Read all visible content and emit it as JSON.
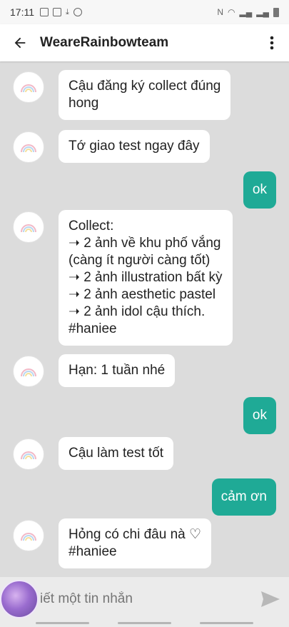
{
  "status_bar": {
    "time": "17:11"
  },
  "header": {
    "title": "WeareRainbowteam"
  },
  "messages": [
    {
      "side": "in",
      "text": "Cậu đăng ký collect đúng\nhong"
    },
    {
      "side": "in",
      "text": "Tớ giao test ngay đây"
    },
    {
      "side": "out",
      "text": "ok"
    },
    {
      "side": "in",
      "text": "Collect:\n➝ 2 ảnh về khu phố vắng\n(càng ít người càng tốt)\n➝ 2 ảnh illustration bất kỳ\n➝ 2 ảnh aesthetic pastel\n➝ 2 ảnh idol cậu thích.\n#haniee"
    },
    {
      "side": "in",
      "text": "Hạn: 1 tuần nhé"
    },
    {
      "side": "out",
      "text": "ok"
    },
    {
      "side": "in",
      "text": "Cậu làm test tốt"
    },
    {
      "side": "out",
      "text": "cảm ơn"
    },
    {
      "side": "in",
      "text": "Hỏng có chi đâu nà ♡\n#haniee"
    }
  ],
  "composer": {
    "placeholder": "iết một tin nhắn"
  },
  "colors": {
    "accent": "#1faa96",
    "background": "#dcdcdc"
  },
  "icons": {
    "back": "arrow-left-icon",
    "menu": "more-vertical-icon",
    "send": "send-icon",
    "avatar": "rainbow-avatar-icon"
  }
}
